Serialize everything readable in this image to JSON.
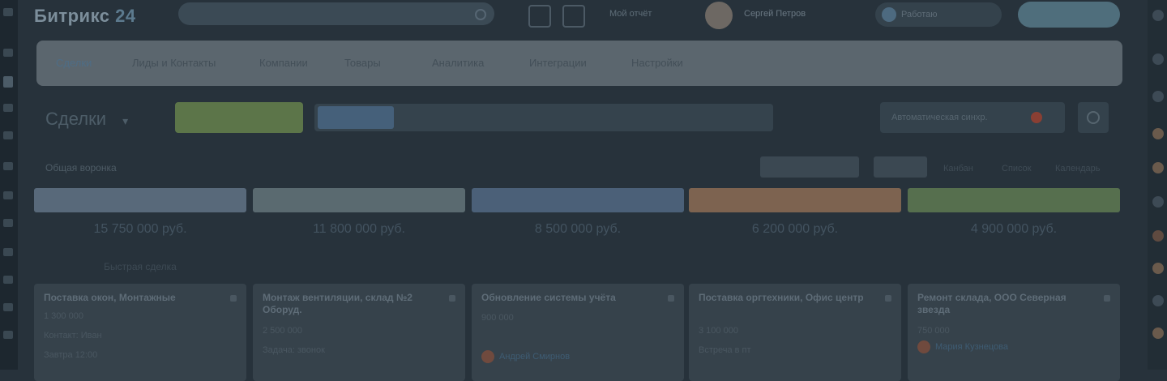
{
  "app": {
    "logo": "Битрикс",
    "logo_num": "24",
    "search_placeholder": "",
    "tb_text": "Мой отчёт",
    "user_name": "Сергей Петров",
    "status_label": "Работаю",
    "invite_label": ""
  },
  "nav": {
    "items": [
      "Сделки",
      "Лиды и Контакты",
      "Компании",
      "Товары",
      "Аналитика",
      "Интеграции",
      "Настройки"
    ]
  },
  "toolbar": {
    "title": "Сделки",
    "add_label": "",
    "filter_chip": "",
    "autosync_label": "Автоматическая синхр.",
    "sub_left": "Общая воронка",
    "sub_btn1": "",
    "sub_btn2": "",
    "sub_links": [
      "Канбан",
      "Список",
      "Календарь"
    ]
  },
  "colors": {
    "col1": "#58697a",
    "col2": "#5a6a70",
    "col3": "#4b6078",
    "col4": "#7d6350",
    "col5": "#566f4e"
  },
  "columns": [
    {
      "head_color": "#58697a",
      "sum": "15 750 000 руб.",
      "quick": "Быстрая сделка",
      "card": {
        "title": "Поставка окон, Монтажные",
        "lines": [
          "1 300 000",
          "Контакт: Иван",
          "Завтра 12:00"
        ]
      }
    },
    {
      "head_color": "#5a6a70",
      "sum": "11 800 000 руб.",
      "quick": "",
      "card": {
        "title": "Монтаж вентиляции, склад №2 Оборуд.",
        "lines": [
          "2 500 000",
          "Задача: звонок"
        ]
      }
    },
    {
      "head_color": "#4b6078",
      "sum": "8 500 000 руб.",
      "quick": "",
      "card": {
        "title": "Обновление системы учёта",
        "lines": [
          "900 000"
        ],
        "responsible": "Андрей Смирнов"
      }
    },
    {
      "head_color": "#7d6350",
      "sum": "6 200 000 руб.",
      "quick": "",
      "card": {
        "title": "Поставка оргтехники, Офис центр",
        "lines": [
          "3 100 000",
          "Встреча в пт"
        ]
      }
    },
    {
      "head_color": "#566f4e",
      "sum": "4 900 000 руб.",
      "quick": "",
      "card": {
        "title": "Ремонт склада, ООО Северная звезда",
        "lines": [
          "750 000"
        ],
        "responsible": "Мария Кузнецова"
      }
    }
  ]
}
